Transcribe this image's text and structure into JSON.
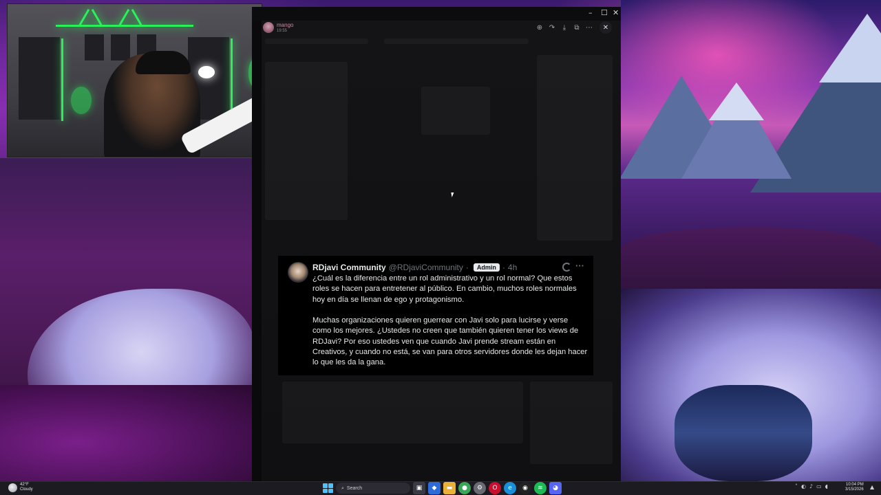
{
  "stream_chat": {
    "username": "mango",
    "time": "19:55"
  },
  "viewer_toolbar": {
    "zoom_icon": "zoom-in-icon",
    "forward_icon": "forward-icon",
    "download_icon": "download-icon",
    "open_icon": "open-external-icon",
    "more_icon": "more-icon",
    "close_icon": "close-icon"
  },
  "tweet": {
    "name": "RDjavi Community",
    "handle": "@RDjaviCommunity",
    "separator": "·",
    "badge": "Admin",
    "time": "4h",
    "body": "¿Cuál es la diferencia entre un rol administrativo y un rol normal? Que estos roles se hacen para entretener al público. En cambio, muchos roles normales hoy en día se llenan de ego y protagonismo.\n\nMuchas organizaciones quieren guerrear con Javi solo para lucirse y verse como los mejores. ¿Ustedes no creen que también quieren tener los views de RDJavi? Por eso ustedes ven que cuando Javi prende stream están en Creativos, y cuando no está, se van para otros servidores donde les dejan hacer lo que les da la gana."
  },
  "taskbar": {
    "weather_temp": "42°F",
    "weather_desc": "Cloudy",
    "search_label": "Search",
    "clock_time": "10:04 PM",
    "clock_date": "3/15/2026"
  },
  "colors": {
    "accent": "#4cc2ff",
    "badge_bg": "#e7e9ea",
    "tweet_bg": "#000000"
  }
}
